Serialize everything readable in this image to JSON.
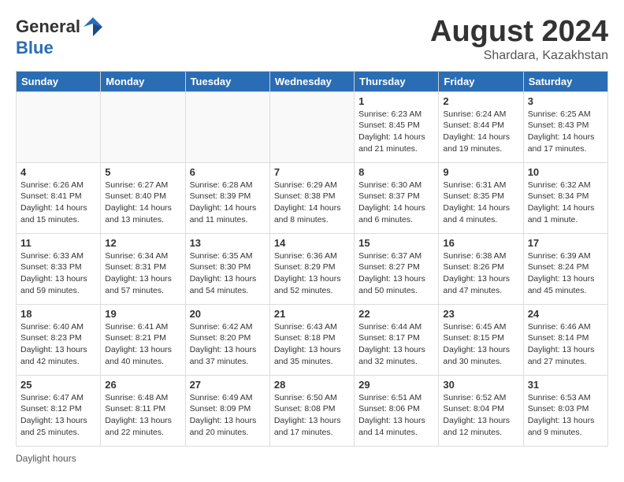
{
  "header": {
    "logo_general": "General",
    "logo_blue": "Blue",
    "month_year": "August 2024",
    "location": "Shardara, Kazakhstan"
  },
  "weekdays": [
    "Sunday",
    "Monday",
    "Tuesday",
    "Wednesday",
    "Thursday",
    "Friday",
    "Saturday"
  ],
  "weeks": [
    [
      {
        "day": "",
        "info": ""
      },
      {
        "day": "",
        "info": ""
      },
      {
        "day": "",
        "info": ""
      },
      {
        "day": "",
        "info": ""
      },
      {
        "day": "1",
        "info": "Sunrise: 6:23 AM\nSunset: 8:45 PM\nDaylight: 14 hours and 21 minutes."
      },
      {
        "day": "2",
        "info": "Sunrise: 6:24 AM\nSunset: 8:44 PM\nDaylight: 14 hours and 19 minutes."
      },
      {
        "day": "3",
        "info": "Sunrise: 6:25 AM\nSunset: 8:43 PM\nDaylight: 14 hours and 17 minutes."
      }
    ],
    [
      {
        "day": "4",
        "info": "Sunrise: 6:26 AM\nSunset: 8:41 PM\nDaylight: 14 hours and 15 minutes."
      },
      {
        "day": "5",
        "info": "Sunrise: 6:27 AM\nSunset: 8:40 PM\nDaylight: 14 hours and 13 minutes."
      },
      {
        "day": "6",
        "info": "Sunrise: 6:28 AM\nSunset: 8:39 PM\nDaylight: 14 hours and 11 minutes."
      },
      {
        "day": "7",
        "info": "Sunrise: 6:29 AM\nSunset: 8:38 PM\nDaylight: 14 hours and 8 minutes."
      },
      {
        "day": "8",
        "info": "Sunrise: 6:30 AM\nSunset: 8:37 PM\nDaylight: 14 hours and 6 minutes."
      },
      {
        "day": "9",
        "info": "Sunrise: 6:31 AM\nSunset: 8:35 PM\nDaylight: 14 hours and 4 minutes."
      },
      {
        "day": "10",
        "info": "Sunrise: 6:32 AM\nSunset: 8:34 PM\nDaylight: 14 hours and 1 minute."
      }
    ],
    [
      {
        "day": "11",
        "info": "Sunrise: 6:33 AM\nSunset: 8:33 PM\nDaylight: 13 hours and 59 minutes."
      },
      {
        "day": "12",
        "info": "Sunrise: 6:34 AM\nSunset: 8:31 PM\nDaylight: 13 hours and 57 minutes."
      },
      {
        "day": "13",
        "info": "Sunrise: 6:35 AM\nSunset: 8:30 PM\nDaylight: 13 hours and 54 minutes."
      },
      {
        "day": "14",
        "info": "Sunrise: 6:36 AM\nSunset: 8:29 PM\nDaylight: 13 hours and 52 minutes."
      },
      {
        "day": "15",
        "info": "Sunrise: 6:37 AM\nSunset: 8:27 PM\nDaylight: 13 hours and 50 minutes."
      },
      {
        "day": "16",
        "info": "Sunrise: 6:38 AM\nSunset: 8:26 PM\nDaylight: 13 hours and 47 minutes."
      },
      {
        "day": "17",
        "info": "Sunrise: 6:39 AM\nSunset: 8:24 PM\nDaylight: 13 hours and 45 minutes."
      }
    ],
    [
      {
        "day": "18",
        "info": "Sunrise: 6:40 AM\nSunset: 8:23 PM\nDaylight: 13 hours and 42 minutes."
      },
      {
        "day": "19",
        "info": "Sunrise: 6:41 AM\nSunset: 8:21 PM\nDaylight: 13 hours and 40 minutes."
      },
      {
        "day": "20",
        "info": "Sunrise: 6:42 AM\nSunset: 8:20 PM\nDaylight: 13 hours and 37 minutes."
      },
      {
        "day": "21",
        "info": "Sunrise: 6:43 AM\nSunset: 8:18 PM\nDaylight: 13 hours and 35 minutes."
      },
      {
        "day": "22",
        "info": "Sunrise: 6:44 AM\nSunset: 8:17 PM\nDaylight: 13 hours and 32 minutes."
      },
      {
        "day": "23",
        "info": "Sunrise: 6:45 AM\nSunset: 8:15 PM\nDaylight: 13 hours and 30 minutes."
      },
      {
        "day": "24",
        "info": "Sunrise: 6:46 AM\nSunset: 8:14 PM\nDaylight: 13 hours and 27 minutes."
      }
    ],
    [
      {
        "day": "25",
        "info": "Sunrise: 6:47 AM\nSunset: 8:12 PM\nDaylight: 13 hours and 25 minutes."
      },
      {
        "day": "26",
        "info": "Sunrise: 6:48 AM\nSunset: 8:11 PM\nDaylight: 13 hours and 22 minutes."
      },
      {
        "day": "27",
        "info": "Sunrise: 6:49 AM\nSunset: 8:09 PM\nDaylight: 13 hours and 20 minutes."
      },
      {
        "day": "28",
        "info": "Sunrise: 6:50 AM\nSunset: 8:08 PM\nDaylight: 13 hours and 17 minutes."
      },
      {
        "day": "29",
        "info": "Sunrise: 6:51 AM\nSunset: 8:06 PM\nDaylight: 13 hours and 14 minutes."
      },
      {
        "day": "30",
        "info": "Sunrise: 6:52 AM\nSunset: 8:04 PM\nDaylight: 13 hours and 12 minutes."
      },
      {
        "day": "31",
        "info": "Sunrise: 6:53 AM\nSunset: 8:03 PM\nDaylight: 13 hours and 9 minutes."
      }
    ]
  ],
  "footer": {
    "note": "Daylight hours"
  }
}
